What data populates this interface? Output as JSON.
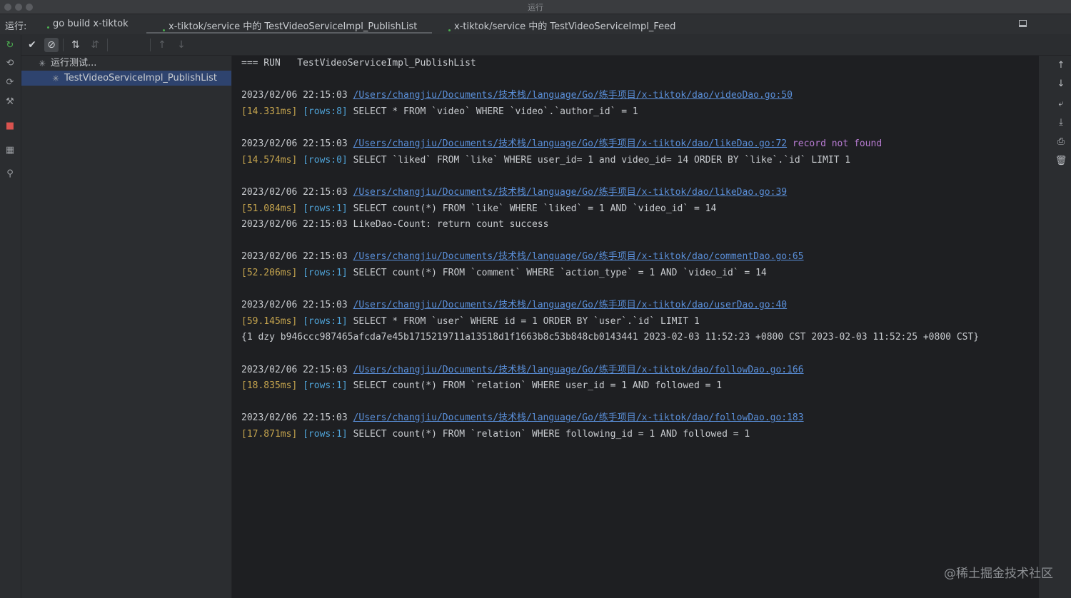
{
  "window": {
    "title": "运行"
  },
  "tabbar": {
    "run_label": "运行:",
    "tabs": [
      {
        "label": "go build x-tiktok"
      },
      {
        "label": "x-tiktok/service 中的 TestVideoServiceImpl_PublishList"
      },
      {
        "label": "x-tiktok/service 中的 TestVideoServiceImpl_Feed"
      }
    ]
  },
  "tree": {
    "items": [
      {
        "label": "运行测试..."
      },
      {
        "label": "TestVideoServiceImpl_PublishList"
      }
    ]
  },
  "console": {
    "header": "=== RUN   TestVideoServiceImpl_PublishList",
    "blocks": [
      {
        "ts": "2023/02/06 22:15:03 ",
        "link": "/Users/changjiu/Documents/技术栈/language/Go/练手项目/x-tiktok/dao/videoDao.go:50",
        "ms": "[14.331ms]",
        "rows": "[rows:8]",
        "sql": "SELECT * FROM `video` WHERE `video`.`author_id` = 1"
      },
      {
        "ts": "2023/02/06 22:15:03 ",
        "link": "/Users/changjiu/Documents/技术栈/language/Go/练手项目/x-tiktok/dao/likeDao.go:72",
        "err": " record not found",
        "ms": "[14.574ms]",
        "rows": "[rows:0]",
        "sql": "SELECT `liked` FROM `like` WHERE user_id= 1 and video_id= 14 ORDER BY `like`.`id` LIMIT 1"
      },
      {
        "ts": "2023/02/06 22:15:03 ",
        "link": "/Users/changjiu/Documents/技术栈/language/Go/练手项目/x-tiktok/dao/likeDao.go:39",
        "ms": "[51.084ms]",
        "rows": "[rows:1]",
        "sql": "SELECT count(*) FROM `like` WHERE `liked` = 1 AND `video_id` = 14",
        "extra": "2023/02/06 22:15:03 LikeDao-Count: return count success"
      },
      {
        "ts": "2023/02/06 22:15:03 ",
        "link": "/Users/changjiu/Documents/技术栈/language/Go/练手项目/x-tiktok/dao/commentDao.go:65",
        "ms": "[52.206ms]",
        "rows": "[rows:1]",
        "sql": "SELECT count(*) FROM `comment` WHERE `action_type` = 1 AND `video_id` = 14"
      },
      {
        "ts": "2023/02/06 22:15:03 ",
        "link": "/Users/changjiu/Documents/技术栈/language/Go/练手项目/x-tiktok/dao/userDao.go:40",
        "ms": "[59.145ms]",
        "rows": "[rows:1]",
        "sql": "SELECT * FROM `user` WHERE id = 1 ORDER BY `user`.`id` LIMIT 1",
        "extra": "{1 dzy b946ccc987465afcda7e45b1715219711a13518d1f1663b8c53b848cb0143441 2023-02-03 11:52:23 +0800 CST 2023-02-03 11:52:25 +0800 CST}"
      },
      {
        "ts": "2023/02/06 22:15:03 ",
        "link": "/Users/changjiu/Documents/技术栈/language/Go/练手项目/x-tiktok/dao/followDao.go:166",
        "ms": "[18.835ms]",
        "rows": "[rows:1]",
        "sql": "SELECT count(*) FROM `relation` WHERE user_id = 1 AND followed = 1"
      },
      {
        "ts": "2023/02/06 22:15:03 ",
        "link": "/Users/changjiu/Documents/技术栈/language/Go/练手项目/x-tiktok/dao/followDao.go:183",
        "ms": "[17.871ms]",
        "rows": "[rows:1]",
        "sql": "SELECT count(*) FROM `relation` WHERE following_id = 1 AND followed = 1"
      }
    ]
  },
  "watermark": "@稀土掘金技术社区"
}
